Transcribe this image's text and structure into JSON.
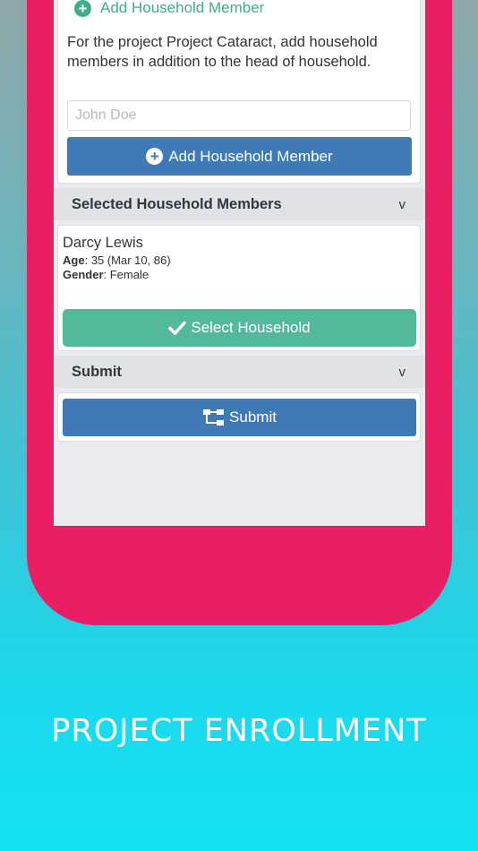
{
  "add_member_link": "Add Household Member",
  "description": "For the project Project Cataract, add household members in addition to the head of household.",
  "name_input": {
    "placeholder": "John Doe",
    "value": ""
  },
  "add_member_button": "Add Household Member",
  "selected_section": {
    "title": "Selected Household Members",
    "chevron": "v"
  },
  "member": {
    "name": "Darcy Lewis",
    "age_label": "Age",
    "age_value": ": 35 (Mar 10, 86)",
    "gender_label": "Gender",
    "gender_value": ": Female"
  },
  "select_household_button": "Select Household",
  "submit_section": {
    "title": "Submit",
    "chevron": "v"
  },
  "submit_button": "Submit",
  "caption": "PROJECT ENROLLMENT",
  "colors": {
    "phone": "#e91e63",
    "primary": "#3f7ab7",
    "success": "#52b99a",
    "link": "#3cae8a"
  },
  "icons": {
    "plus": "plus-circle-icon",
    "check": "check-icon",
    "sitemap": "sitemap-icon",
    "chevron": "chevron-down-icon"
  }
}
